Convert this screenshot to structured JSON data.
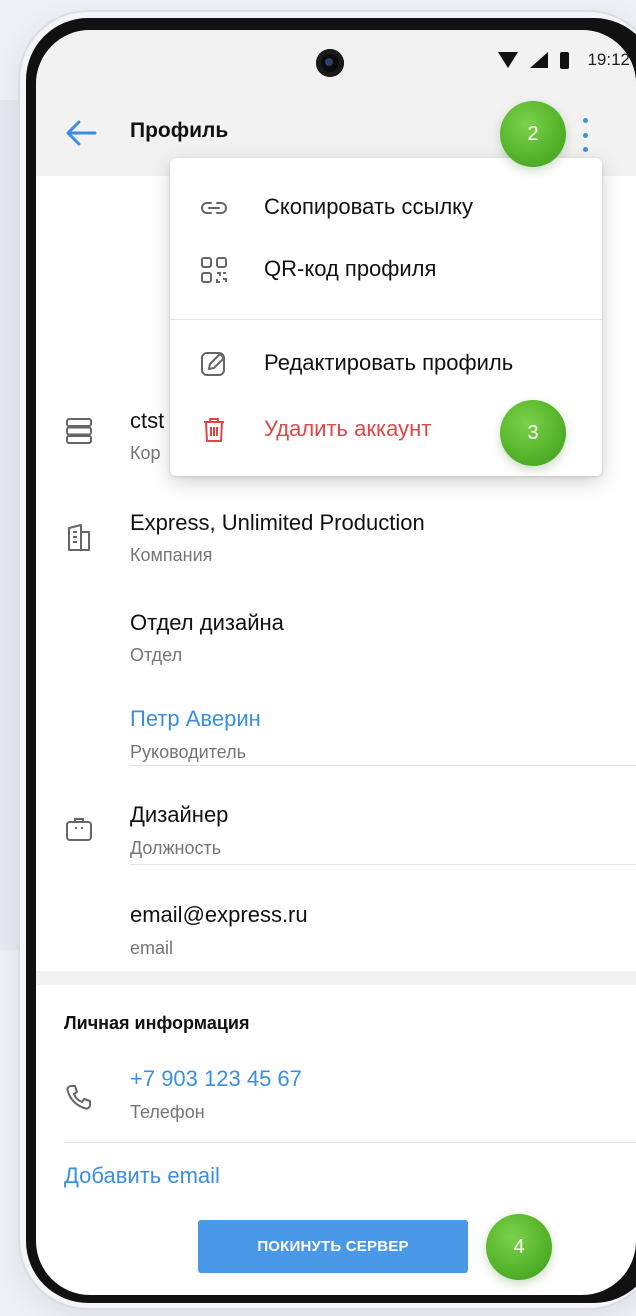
{
  "status_bar": {
    "time": "19:12"
  },
  "appbar": {
    "title": "Профиль"
  },
  "menu": {
    "items": [
      {
        "label": "Скопировать ссылку",
        "icon": "link-icon"
      },
      {
        "label": "QR-код профиля",
        "icon": "qr-code-icon"
      },
      {
        "label": "Редактировать профиль",
        "icon": "edit-icon"
      },
      {
        "label": "Удалить аккаунт",
        "icon": "trash-icon"
      }
    ]
  },
  "profile": {
    "corporate": {
      "title": "ctst",
      "subtitle": "Кор"
    },
    "company": {
      "title": "Express, Unlimited Production",
      "subtitle": "Компания"
    },
    "department": {
      "title": "Отдел дизайна",
      "subtitle": "Отдел"
    },
    "manager": {
      "title": "Петр Аверин",
      "subtitle": "Руководитель"
    },
    "position": {
      "title": "Дизайнер",
      "subtitle": "Должность"
    },
    "email": {
      "title": "email@express.ru",
      "subtitle": "email"
    }
  },
  "personal": {
    "section_title": "Личная информация",
    "phone": {
      "title": "+7 903 123 45 67",
      "subtitle": "Телефон"
    },
    "add_email": "Добавить email"
  },
  "leave_button": "ПОКИНУТЬ СЕРВЕР",
  "badges": [
    "2",
    "3",
    "4"
  ],
  "colors": {
    "accent": "#3b8fe0",
    "danger": "#e04545",
    "badge": "#56b52c"
  }
}
